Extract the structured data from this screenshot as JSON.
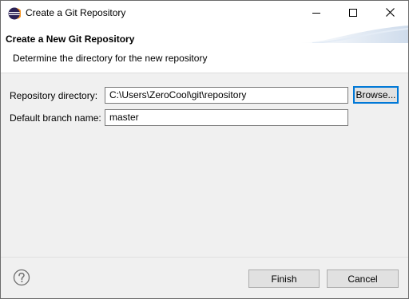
{
  "window": {
    "title": "Create a Git Repository"
  },
  "banner": {
    "title": "Create a New Git Repository",
    "description": "Determine the directory for the new repository"
  },
  "form": {
    "repository_label": "Repository directory:",
    "repository_value": "C:\\Users\\ZeroCool\\git\\repository",
    "browse_label": "Browse...",
    "branch_label": "Default branch name:",
    "branch_value": "master"
  },
  "footer": {
    "finish_label": "Finish",
    "cancel_label": "Cancel"
  },
  "icons": {
    "app": "eclipse-icon",
    "minimize": "minimize-icon",
    "maximize": "maximize-icon",
    "close": "close-icon",
    "help": "help-icon"
  },
  "colors": {
    "accent": "#0078d7",
    "dialog_background": "#f0f0f0",
    "banner_background": "#ffffff",
    "app_icon_purple": "#2c2255",
    "app_icon_orange": "#f7941e"
  }
}
